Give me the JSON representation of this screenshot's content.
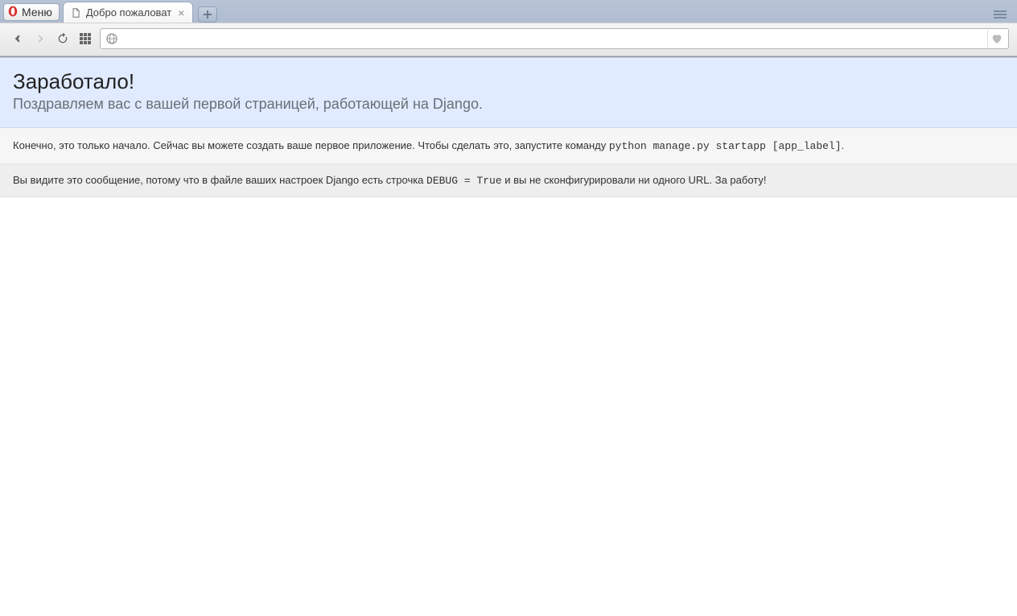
{
  "chrome": {
    "menu_label": "Меню",
    "tab_title": "Добро пожаловат",
    "url_value": ""
  },
  "page": {
    "heading": "Заработало!",
    "subheading": "Поздравляем вас с вашей первой страницей, работающей на Django.",
    "instructions_pre": "Конечно, это только начало. Сейчас вы можете создать ваше первое приложение. Чтобы сделать это, запустите команду ",
    "instructions_code": "python manage.py startapp [app_label]",
    "instructions_post": ".",
    "explanation_pre": "Вы видите это сообщение, потому что в файле ваших настроек Django есть строчка ",
    "explanation_code": "DEBUG = True",
    "explanation_post": " и вы не сконфигурировали ни одного URL. За работу!"
  }
}
